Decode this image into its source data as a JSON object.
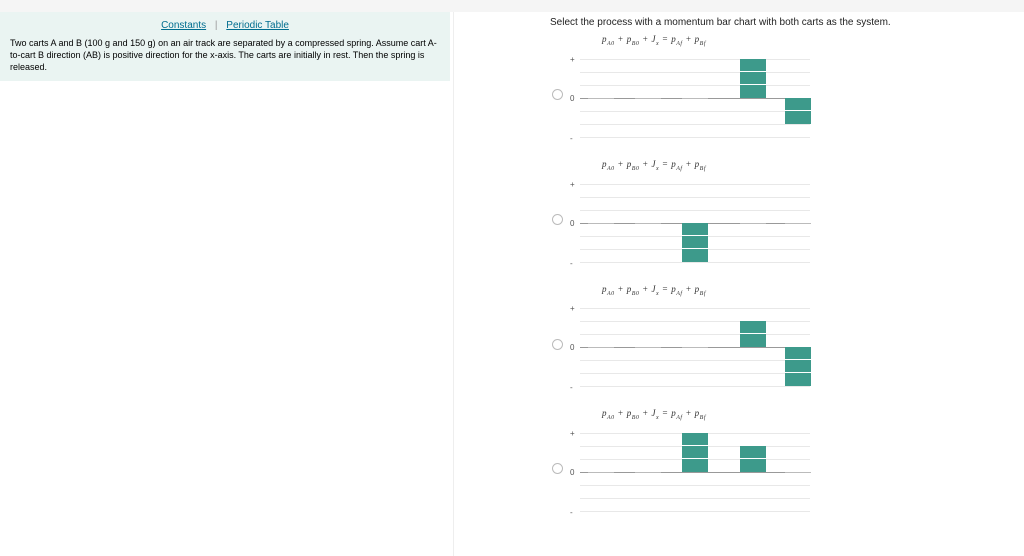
{
  "links": {
    "constants": "Constants",
    "periodic": "Periodic Table",
    "sep": "|"
  },
  "problem": "Two carts A and B (100 g and 150 g) on an air track are separated by a compressed spring. Assume cart A-to-cart B direction (AB) is positive direction for the x-axis. The carts are initially in rest. Then the spring is released.",
  "prompt": "Select the process with a momentum bar chart with both carts as the system.",
  "eq_html": "p<sub>A0</sub> + p<sub>B0</sub> + J<sub>x</sub> = p<sub>Af</sub> + p<sub>Bf</sub>",
  "axis": {
    "plus": "+",
    "zero": "0",
    "minus": "-"
  },
  "chart_data": [
    {
      "type": "bar",
      "categories": [
        "pA0",
        "pB0",
        "Jx",
        "pAf",
        "pBf"
      ],
      "values": [
        0,
        0,
        0,
        3,
        -2
      ],
      "ylim": [
        -3,
        3
      ]
    },
    {
      "type": "bar",
      "categories": [
        "pA0",
        "pB0",
        "Jx",
        "pAf",
        "pBf"
      ],
      "values": [
        0,
        0,
        -3,
        0,
        0
      ],
      "ylim": [
        -3,
        3
      ]
    },
    {
      "type": "bar",
      "categories": [
        "pA0",
        "pB0",
        "Jx",
        "pAf",
        "pBf"
      ],
      "values": [
        0,
        0,
        0,
        2,
        -3
      ],
      "ylim": [
        -3,
        3
      ]
    },
    {
      "type": "bar",
      "categories": [
        "pA0",
        "pB0",
        "Jx",
        "pAf",
        "pBf"
      ],
      "values": [
        0,
        0,
        3,
        2,
        0
      ],
      "ylim": [
        -3,
        3
      ]
    }
  ]
}
